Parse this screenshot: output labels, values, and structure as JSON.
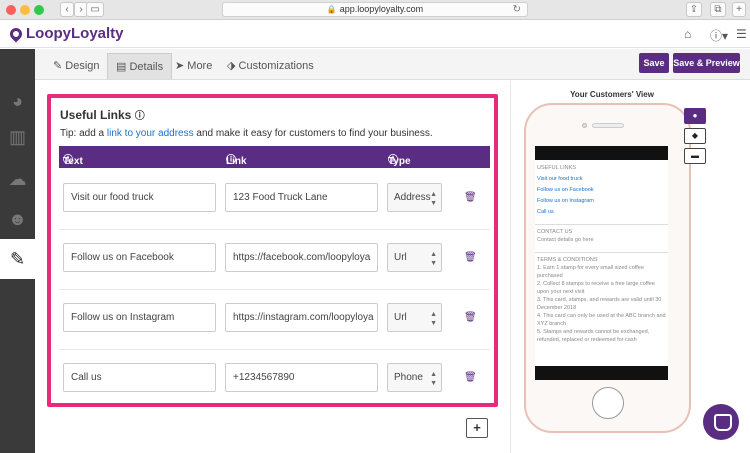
{
  "browser": {
    "url": "app.loopyloyalty.com"
  },
  "app": {
    "brand": "LoopyLoyalty",
    "accent": "#5a2d82",
    "highlight": "#e62b7a"
  },
  "tabs": [
    {
      "label": "Design",
      "icon": "brush-icon"
    },
    {
      "label": "Details",
      "icon": "document-icon"
    },
    {
      "label": "More",
      "icon": "send-icon"
    },
    {
      "label": "Customizations",
      "icon": "tag-icon"
    }
  ],
  "actions": {
    "save": "Save",
    "save_preview": "Save & Preview"
  },
  "useful_links": {
    "title": "Useful Links",
    "tip_prefix": "Tip: add a ",
    "tip_link": "link to your address",
    "tip_suffix": " and make it easy for customers to find your business.",
    "columns": {
      "text": "Text",
      "link": "Link",
      "type": "Type"
    },
    "rows": [
      {
        "text": "Visit our food truck",
        "link": "123 Food Truck Lane",
        "type": "Address"
      },
      {
        "text": "Follow us on Facebook",
        "link": "https://facebook.com/loopyloya",
        "type": "Url"
      },
      {
        "text": "Follow us on Instagram",
        "link": "https://instagram.com/loopyloya",
        "type": "Url"
      },
      {
        "text": "Call us",
        "link": "+1234567890",
        "type": "Phone"
      }
    ],
    "add": "+"
  },
  "preview": {
    "title": "Your Customers' View",
    "useful_links_heading": "USEFUL LINKS",
    "links": [
      "Visit our food truck",
      "Follow us on Facebook",
      "Follow us on Instagram",
      "Call us"
    ],
    "contact_heading": "CONTACT US",
    "contact_text": "Contact details go here",
    "terms_heading": "TERMS & CONDITIONS",
    "terms": [
      "1. Earn 1 stamp for every small sized coffee purchased",
      "2. Collect 8 stamps to receive a free large coffee upon your next visit",
      "3. This card, stamps, and rewards are valid until 30 December 2018",
      "4. This card can only be used at the ABC branch and XYZ branch",
      "5. Stamps and rewards cannot be exchanged, refunded, replaced or redeemed for cash"
    ]
  }
}
